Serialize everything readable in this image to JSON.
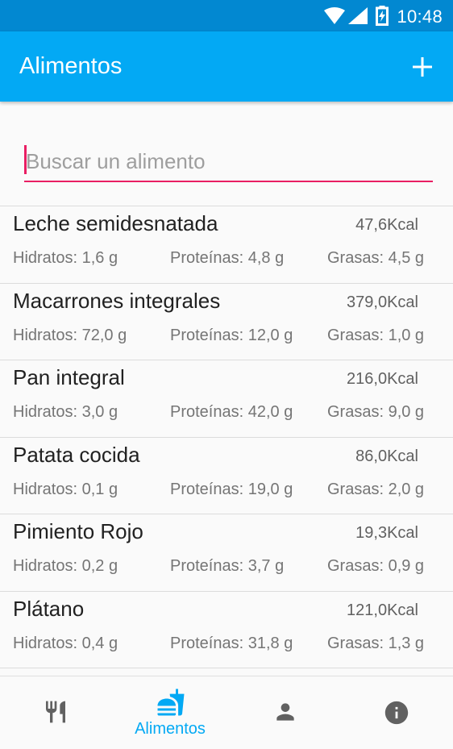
{
  "status_bar": {
    "time": "10:48",
    "icons": [
      "wifi-icon",
      "signal-icon",
      "battery-charging-icon"
    ]
  },
  "app_bar": {
    "title": "Alimentos",
    "action_icon": "add-icon"
  },
  "search": {
    "placeholder": "Buscar un alimento",
    "value": ""
  },
  "colors": {
    "primary": "#03a9f4",
    "primary_dark": "#0288d1",
    "accent": "#e91e63"
  },
  "foods": [
    {
      "name": "Leche semidesnatada",
      "kcal": "47,6Kcal",
      "hidratos": "Hidratos: 1,6 g",
      "proteinas": "Proteínas: 4,8 g",
      "grasas": "Grasas: 4,5 g"
    },
    {
      "name": "Macarrones integrales",
      "kcal": "379,0Kcal",
      "hidratos": "Hidratos: 72,0 g",
      "proteinas": "Proteínas: 12,0 g",
      "grasas": "Grasas: 1,0 g"
    },
    {
      "name": "Pan integral",
      "kcal": "216,0Kcal",
      "hidratos": "Hidratos: 3,0 g",
      "proteinas": "Proteínas: 42,0 g",
      "grasas": "Grasas: 9,0 g"
    },
    {
      "name": "Patata cocida",
      "kcal": "86,0Kcal",
      "hidratos": "Hidratos: 0,1 g",
      "proteinas": "Proteínas: 19,0 g",
      "grasas": "Grasas: 2,0 g"
    },
    {
      "name": "Pimiento Rojo",
      "kcal": "19,3Kcal",
      "hidratos": "Hidratos: 0,2 g",
      "proteinas": "Proteínas: 3,7 g",
      "grasas": "Grasas: 0,9 g"
    },
    {
      "name": "Plátano",
      "kcal": "121,0Kcal",
      "hidratos": "Hidratos: 0,4 g",
      "proteinas": "Proteínas: 31,8 g",
      "grasas": "Grasas: 1,3 g"
    }
  ],
  "bottom_nav": {
    "items": [
      {
        "icon": "restaurant-icon",
        "label": ""
      },
      {
        "icon": "fastfood-icon",
        "label": "Alimentos",
        "active": true
      },
      {
        "icon": "person-icon",
        "label": ""
      },
      {
        "icon": "info-icon",
        "label": ""
      }
    ]
  }
}
